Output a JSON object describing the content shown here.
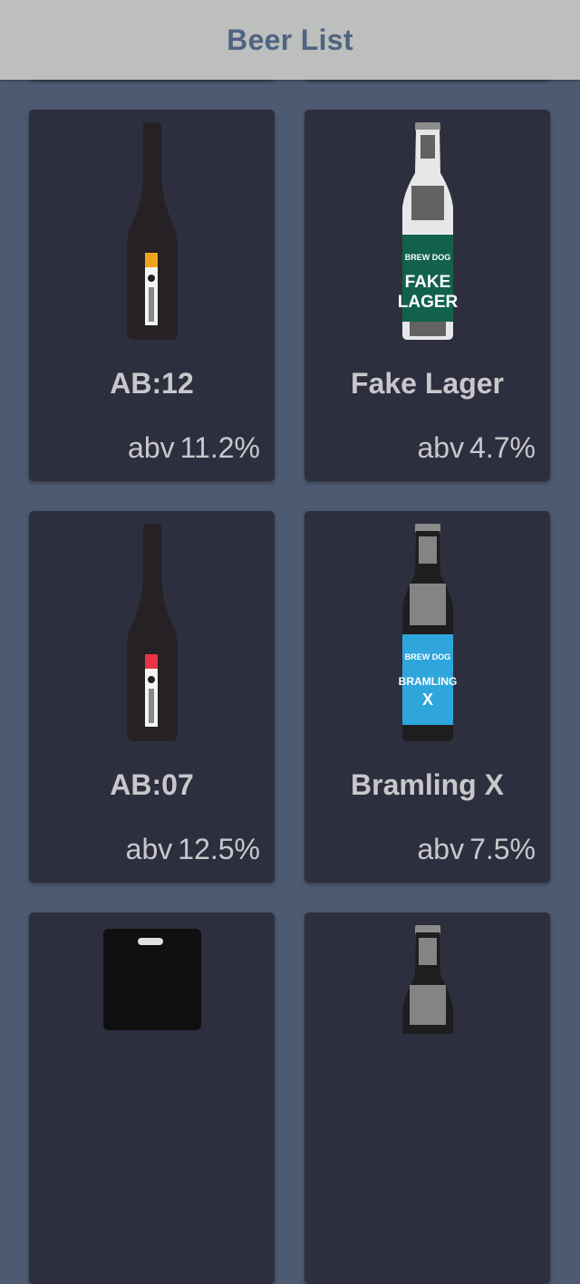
{
  "header": {
    "title": "Beer List"
  },
  "beers": [
    {
      "name": "AB:12",
      "abv_prefix": "abv",
      "abv": "11.2%",
      "label_text": "abstrakt",
      "label_color": "#f2a31c",
      "style": "wine-bottle"
    },
    {
      "name": "Fake Lager",
      "abv_prefix": "abv",
      "abv": "4.7%",
      "label_text_1": "FAKE",
      "label_text_2": "LAGER",
      "brand": "BREW DOG",
      "label_color": "#12614d",
      "style": "beer-bottle"
    },
    {
      "name": "AB:07",
      "abv_prefix": "abv",
      "abv": "12.5%",
      "label_text": "abstrakt",
      "label_color": "#ea3345",
      "style": "wine-bottle"
    },
    {
      "name": "Bramling X",
      "abv_prefix": "abv",
      "abv": "7.5%",
      "label_text_1": "BRAMLING",
      "label_text_2": "X",
      "brand": "BREW DOG",
      "label_color": "#2ea6dc",
      "style": "beer-bottle"
    }
  ],
  "colors": {
    "background": "#4e5a71",
    "card": "#2d2f3f",
    "header": "#bdbebe",
    "header_text": "#4e6580",
    "text": "#c8c8cc"
  }
}
